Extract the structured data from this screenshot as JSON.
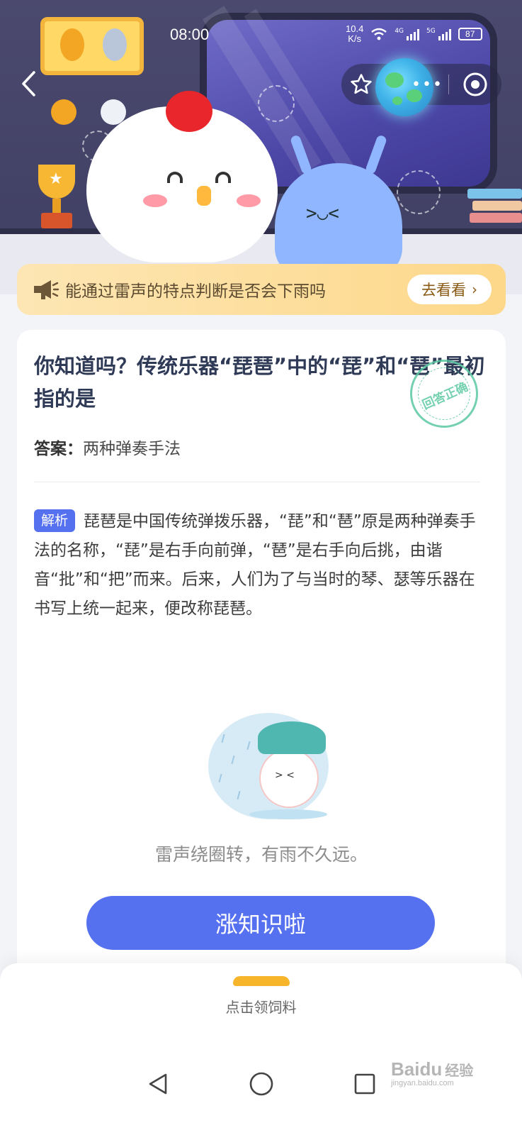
{
  "status_bar": {
    "time": "08:00",
    "net_speed_value": "10.4",
    "net_speed_unit": "K/s",
    "signal1_label": "4G",
    "signal2_label": "5G",
    "battery": "87"
  },
  "nav": {
    "back_icon": "chevron-left-icon",
    "favorite_icon": "star-outline-icon",
    "more_icon": "more-dots-icon",
    "close_icon": "target-circle-icon",
    "more_label": "•••"
  },
  "banner": {
    "text": "能通过雷声的特点判断是否会下雨吗",
    "button_label": "去看看",
    "button_chevron": "›"
  },
  "question": {
    "title": "你知道吗？传统乐器“琵琶”中的“琵”和“琶”最初指的是",
    "stamp_text": "回答正确",
    "answer_label": "答案：",
    "answer_value": "两种弹奏手法",
    "analysis_tag": "解析",
    "analysis_text": "琵琶是中国传统弹拨乐器，“琵”和“琶”原是两种弹奏手法的名称，“琵”是右手向前弹，“琶”是右手向后挑，由谐音“批”和“把”而来。后来，人们为了与当时的琴、瑟等乐器在书写上统一起来，便改称琵琶。",
    "caption": "雷声绕圈转，有雨不久远。",
    "cta_label": "涨知识啦"
  },
  "bottom_sheet": {
    "feed_label": "点击领饲料"
  },
  "watermark": {
    "brand": "Bai",
    "brand_suffix": "du",
    "sub": "经验",
    "domain": "jingyan.baidu.com"
  },
  "colors": {
    "accent": "#5671f0",
    "banner": "#fdd88a",
    "stamp": "#5cc9a3",
    "hero_bg": "#4b4a6e"
  }
}
